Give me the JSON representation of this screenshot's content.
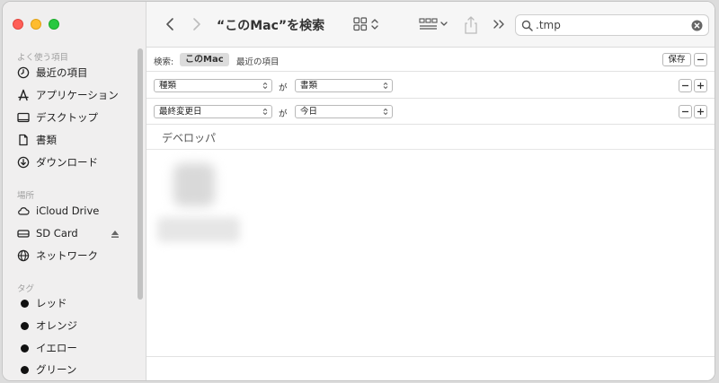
{
  "window": {
    "title": "“このMac”を検索"
  },
  "sidebar": {
    "sections": [
      {
        "label": "よく使う項目",
        "items": [
          {
            "label": "最近の項目",
            "icon": "clock-icon"
          },
          {
            "label": "アプリケーション",
            "icon": "apps-icon"
          },
          {
            "label": "デスクトップ",
            "icon": "desktop-icon"
          },
          {
            "label": "書類",
            "icon": "document-icon"
          },
          {
            "label": "ダウンロード",
            "icon": "download-icon"
          }
        ]
      },
      {
        "label": "場所",
        "items": [
          {
            "label": "iCloud Drive",
            "icon": "cloud-icon"
          },
          {
            "label": "SD Card",
            "icon": "drive-icon"
          },
          {
            "label": "ネットワーク",
            "icon": "globe-icon"
          }
        ]
      },
      {
        "label": "タグ",
        "items": [
          {
            "label": "レッド",
            "icon": "tag-dot-icon"
          },
          {
            "label": "オレンジ",
            "icon": "tag-dot-icon"
          },
          {
            "label": "イエロー",
            "icon": "tag-dot-icon"
          },
          {
            "label": "グリーン",
            "icon": "tag-dot-icon"
          }
        ]
      }
    ]
  },
  "search": {
    "value": ".tmp"
  },
  "scope": {
    "label": "検索:",
    "this_mac": "このMac",
    "recent": "最近の項目",
    "save": "保存"
  },
  "criteria": [
    {
      "attribute": "種類",
      "conjunction": "が",
      "value": "書類"
    },
    {
      "attribute": "最終変更日",
      "conjunction": "が",
      "value": "今日"
    }
  ],
  "results": {
    "group_header": "デベロッパ"
  }
}
